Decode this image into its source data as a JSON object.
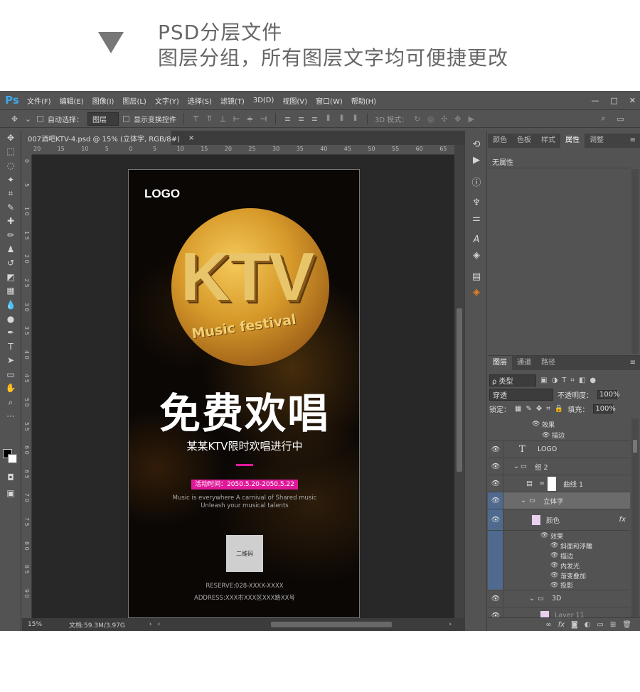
{
  "banner": {
    "line1": "PSD分层文件",
    "line2": "图层分组，所有图层文字均可便捷更改"
  },
  "app": {
    "logo": "Ps",
    "menu": [
      "文件(F)",
      "编辑(E)",
      "图像(I)",
      "图层(L)",
      "文字(Y)",
      "选择(S)",
      "滤镜(T)",
      "3D(D)",
      "视图(V)",
      "窗口(W)",
      "帮助(H)"
    ],
    "window_controls": [
      "—",
      "□",
      "✕"
    ]
  },
  "options": {
    "auto_select_label": "自动选择：",
    "auto_select_value": "图层",
    "show_transform_label": "显示变换控件",
    "mode_3d_label": "3D 模式："
  },
  "document": {
    "tab_title": "007酒吧KTV-4.psd @ 15% (立体字, RGB/8#)",
    "tab_close": "×",
    "ruler_h": [
      "20",
      "15",
      "10",
      "5",
      "0",
      "5",
      "10",
      "15",
      "20",
      "25",
      "30",
      "35",
      "40",
      "45",
      "50",
      "55",
      "60",
      "65"
    ],
    "ruler_v": [
      "0",
      "5",
      "1 0",
      "1 5",
      "2 0",
      "2 5",
      "3 0",
      "3 5",
      "4 0",
      "4 5",
      "5 0",
      "5 5",
      "6 0",
      "6 5",
      "7 0",
      "7 5",
      "8 0",
      "8 5",
      "9 0"
    ],
    "zoom": "15%",
    "doc_info": "文档:59.3M/3.97G"
  },
  "poster": {
    "logo": "LOGO",
    "ktv": "KTV",
    "music": "Music festival",
    "headline": "免费欢唱",
    "subtitle": "某某KTV限时欢唱进行中",
    "date": "活动时间：2050.5.20-2050.5.22",
    "en1": "Music is everywhere A carnival of Shared music",
    "en2": "Unleash your musical talents",
    "qr": "二维码",
    "reserve": "RESERVE:028-XXXX-XXXX",
    "address": "ADDRESS:XXX市XXX区XXX路XX号"
  },
  "properties": {
    "tabs": [
      "颜色",
      "色板",
      "样式",
      "属性",
      "调整"
    ],
    "active_tab": "属性",
    "no_props": "无属性"
  },
  "layers_panel": {
    "tabs": [
      "图层",
      "通道",
      "路径"
    ],
    "kind": "ρ 类型",
    "blend": "穿透",
    "opacity_label": "不透明度：",
    "opacity": "100%",
    "lock_label": "锁定：",
    "fill_label": "填充：",
    "fill": "100%",
    "layers": [
      {
        "name": "效果",
        "type": "effects-header"
      },
      {
        "name": "描边",
        "type": "effect"
      },
      {
        "name": "LOGO",
        "type": "text"
      },
      {
        "name": "组 2",
        "type": "group"
      },
      {
        "name": "曲线 1",
        "type": "adjustment"
      },
      {
        "name": "立体字",
        "type": "group-selected"
      },
      {
        "name": "颜色",
        "type": "smart",
        "fx": "fx"
      },
      {
        "name": "效果",
        "type": "effects-header"
      },
      {
        "name": "斜面和浮雕",
        "type": "effect"
      },
      {
        "name": "描边",
        "type": "effect"
      },
      {
        "name": "内发光",
        "type": "effect"
      },
      {
        "name": "渐变叠加",
        "type": "effect"
      },
      {
        "name": "投影",
        "type": "effect"
      },
      {
        "name": "3D",
        "type": "group"
      },
      {
        "name": "Layer 11",
        "type": "smart"
      }
    ]
  }
}
